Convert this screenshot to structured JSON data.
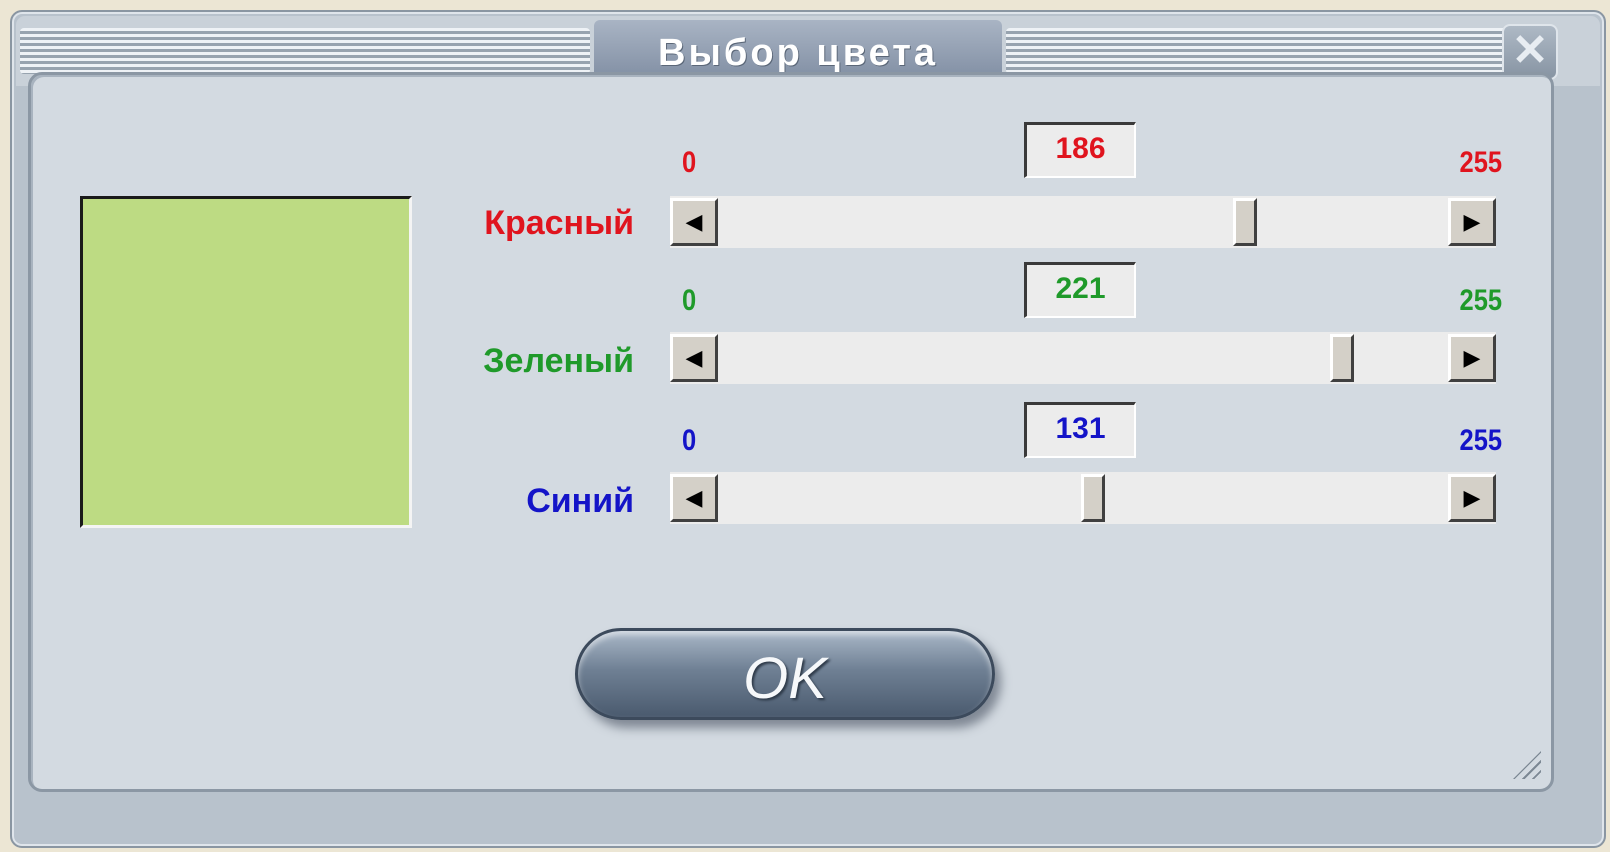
{
  "window": {
    "title": "Выбор цвета",
    "close_glyph": "✕"
  },
  "preview": {
    "color": "#bddb83"
  },
  "channels": [
    {
      "label": "Красный",
      "value": "186",
      "min": "0",
      "max": "255",
      "color": "#e0141e"
    },
    {
      "label": "Зеленый",
      "value": "221",
      "min": "0",
      "max": "255",
      "color": "#1f9a2a"
    },
    {
      "label": "Синий",
      "value": "131",
      "min": "0",
      "max": "255",
      "color": "#1414c8"
    }
  ],
  "scroll_arrows": {
    "left": "◀",
    "right": "▶"
  },
  "ok_button": {
    "label": "OK"
  }
}
